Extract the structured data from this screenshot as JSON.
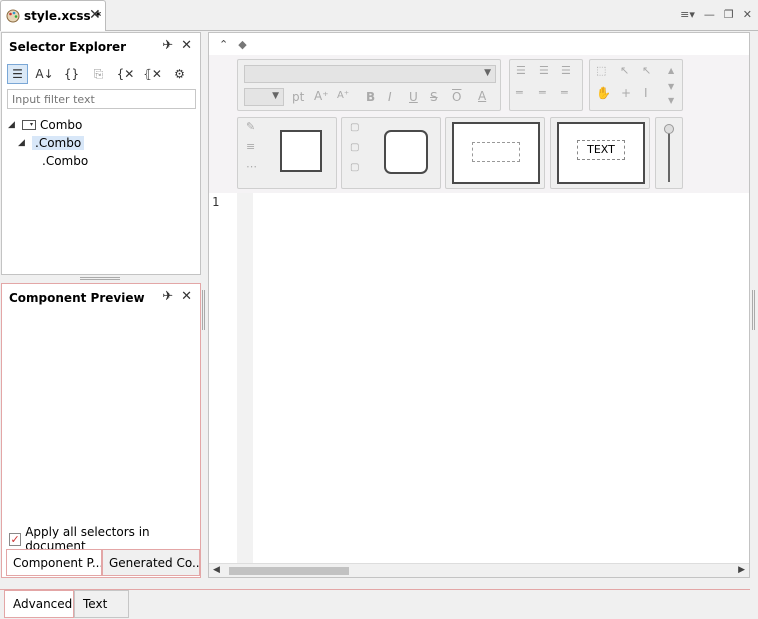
{
  "tab": {
    "title": "style.xcss *",
    "close": "✕"
  },
  "window_controls": [
    "≡▾",
    "—",
    "❐",
    "✕"
  ],
  "selector_explorer": {
    "title": "Selector Explorer",
    "filter_placeholder": "Input filter text",
    "tree": [
      {
        "label": "Combo",
        "level": 0
      },
      {
        "label": ".Combo",
        "level": 1,
        "selected": true
      },
      {
        "label": ".Combo",
        "level": 2
      }
    ]
  },
  "component_preview": {
    "title": "Component Preview",
    "apply_label": "Apply all selectors in document",
    "apply_checked": true,
    "tabs": [
      "Component P...",
      "Generated Co..."
    ]
  },
  "editor": {
    "line_numbers": [
      "1"
    ],
    "palette": {
      "font_size_unit": "pt",
      "text_buttons": [
        "B",
        "I",
        "U",
        "S",
        "O"
      ],
      "preview_text": "TEXT"
    }
  },
  "mode_tabs": [
    "Advanced",
    "Text"
  ],
  "colors": {
    "accent_border": "#e3a6a6",
    "selection": "#d8e7f8"
  }
}
